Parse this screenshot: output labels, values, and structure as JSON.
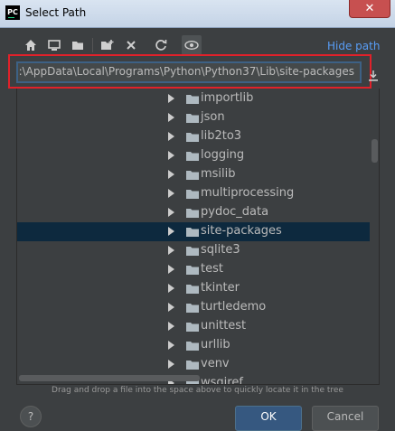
{
  "window": {
    "title": "Select Path",
    "app_icon_label": "PC",
    "close_label": "✕"
  },
  "toolbar": {
    "icons": [
      "home-icon",
      "desktop-icon",
      "project-folder-icon",
      "new-folder-icon",
      "delete-icon",
      "refresh-icon",
      "show-hidden-files-icon"
    ],
    "hide_path_label": "Hide path"
  },
  "path_field": {
    "value": ":\\AppData\\Local\\Programs\\Python\\Python37\\Lib\\site-packages"
  },
  "tree": {
    "items": [
      {
        "label": "importlib",
        "selected": false
      },
      {
        "label": "json",
        "selected": false
      },
      {
        "label": "lib2to3",
        "selected": false
      },
      {
        "label": "logging",
        "selected": false
      },
      {
        "label": "msilib",
        "selected": false
      },
      {
        "label": "multiprocessing",
        "selected": false
      },
      {
        "label": "pydoc_data",
        "selected": false
      },
      {
        "label": "site-packages",
        "selected": true
      },
      {
        "label": "sqlite3",
        "selected": false
      },
      {
        "label": "test",
        "selected": false
      },
      {
        "label": "tkinter",
        "selected": false
      },
      {
        "label": "turtledemo",
        "selected": false
      },
      {
        "label": "unittest",
        "selected": false
      },
      {
        "label": "urllib",
        "selected": false
      },
      {
        "label": "venv",
        "selected": false
      },
      {
        "label": "wsgiref",
        "selected": false
      }
    ]
  },
  "hint": "Drag and drop a file into the space above to quickly locate it in the tree",
  "buttons": {
    "help": "?",
    "ok": "OK",
    "cancel": "Cancel"
  },
  "colors": {
    "background": "#3c3f41",
    "selection": "#0d293e",
    "link": "#589df6",
    "highlight_outline": "#e0212a",
    "folder": "#aeb9c0"
  }
}
